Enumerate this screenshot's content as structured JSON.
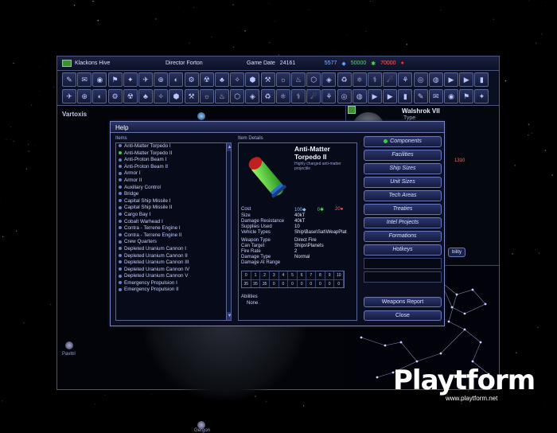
{
  "topbar": {
    "colony": "Klackons Hive",
    "leader": "Director Forton",
    "date_label": "Game Date",
    "date_value": "24161",
    "research": "5577",
    "credits": "50000",
    "pop": "70000"
  },
  "map": {
    "system_left": "Vartoxis",
    "system_right": "Walshrok VII",
    "type_label": "Type",
    "planet_a": "Pavitri",
    "planet_b": "Gergon",
    "ability_btn": "bility",
    "right_num_a": "1310"
  },
  "help": {
    "title": "Help",
    "items_label": "Items",
    "details_label": "Item Details",
    "items": [
      "Anti-Matter Torpedo I",
      "Anti-Matter Torpedo II",
      "Anti-Proton Beam I",
      "Anti-Proton Beam II",
      "Armor I",
      "Armor II",
      "Auxiliary Control",
      "Bridge",
      "Capital Ship Missile I",
      "Capital Ship Missile II",
      "Cargo Bay I",
      "Cobalt Warhead I",
      "Contra - Terrene Engine I",
      "Contra - Terrene Engine II",
      "Crew Quarters",
      "Depleted Uranium Cannon I",
      "Depleted Uranium Cannon II",
      "Depleted Uranium Cannon III",
      "Depleted Uranium Cannon IV",
      "Depleted Uranium Cannon V",
      "Emergency Propulsion I",
      "Emergency Propulsion II"
    ],
    "selected_index": 1,
    "detail": {
      "name": "Anti-Matter Torpedo II",
      "desc": "Highly charged anti-matter projectile",
      "cost_label": "Cost",
      "cost_a": "100",
      "cost_b": "0",
      "cost_c": "20",
      "rows": [
        {
          "label": "Size",
          "value": "40kT"
        },
        {
          "label": "Damage Resistance",
          "value": "40kT"
        },
        {
          "label": "Supplies Used",
          "value": "10"
        },
        {
          "label": "Vehicle Types",
          "value": "Ship\\Base\\Sat\\WeapPlat"
        },
        {
          "label": "Weapon Type",
          "value": "Direct Fire"
        },
        {
          "label": "Can Target",
          "value": "Ships\\Planets"
        },
        {
          "label": "Fire Rate",
          "value": "2"
        },
        {
          "label": "Damage Type",
          "value": "Normal"
        },
        {
          "label": "Damage At Range",
          "value": ""
        }
      ],
      "range_headers": [
        "0",
        "1",
        "2",
        "3",
        "4",
        "5",
        "6",
        "7",
        "8",
        "9",
        "10"
      ],
      "range_values": [
        "35",
        "35",
        "35",
        "0",
        "0",
        "0",
        "0",
        "0",
        "0",
        "0",
        "0"
      ],
      "abilities_label": "Abilities",
      "abilities_value": "None"
    },
    "categories": [
      "Components",
      "Facilities",
      "Ship Sizes",
      "Unit Sizes",
      "Tech Areas",
      "Treaties",
      "Intel Projects",
      "Formations",
      "Hotkeys"
    ],
    "weapons_report": "Weapons Report",
    "close": "Close"
  },
  "watermark": {
    "brand": "Playtform",
    "url": "www.playtform.net"
  },
  "colors": {
    "accent": "#3ad04a",
    "frame": "#5a6794",
    "alert": "#ff4040"
  }
}
